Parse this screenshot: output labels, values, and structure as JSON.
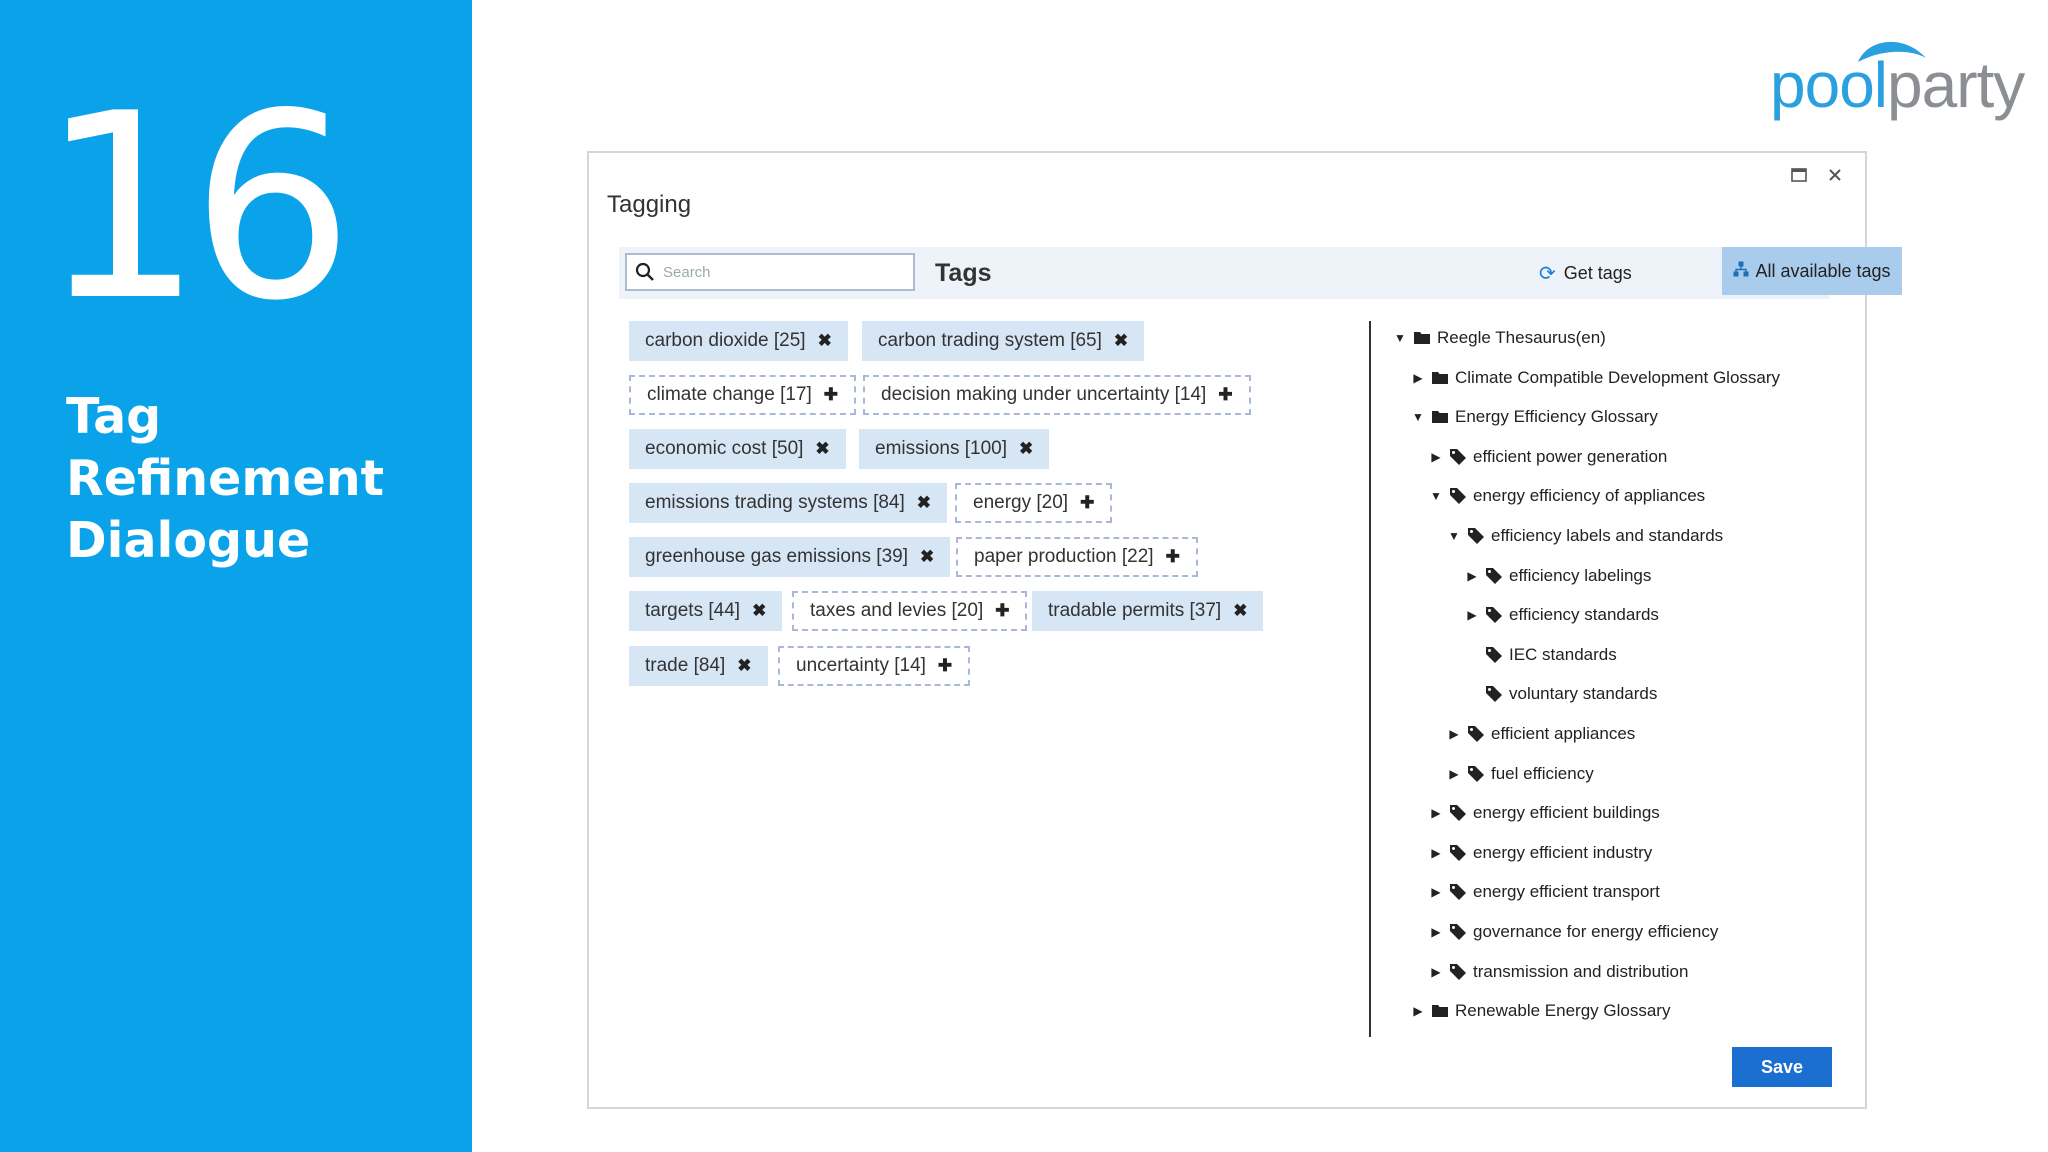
{
  "slide": {
    "number": "16",
    "title_line1": "Tag Refinement",
    "title_line2": "Dialogue"
  },
  "logo": {
    "part1": "pool",
    "part2": "party"
  },
  "dialog": {
    "title": "Tagging",
    "maximize_icon": "maximize-icon",
    "close_icon": "close-icon",
    "search_placeholder": "Search",
    "tags_label": "Tags",
    "get_tags_label": "Get tags",
    "all_tags_label": "All available tags",
    "save_label": "Save"
  },
  "tags": [
    {
      "label": "carbon dioxide [25]",
      "state": "assigned"
    },
    {
      "label": "carbon trading system [65]",
      "state": "assigned"
    },
    {
      "label": "climate change [17]",
      "state": "suggested"
    },
    {
      "label": "decision making under uncertainty [14]",
      "state": "suggested"
    },
    {
      "label": "economic cost [50]",
      "state": "assigned"
    },
    {
      "label": "emissions [100]",
      "state": "assigned"
    },
    {
      "label": "emissions trading systems [84]",
      "state": "assigned"
    },
    {
      "label": "energy [20]",
      "state": "suggested"
    },
    {
      "label": "greenhouse gas emissions [39]",
      "state": "assigned"
    },
    {
      "label": "paper production [22]",
      "state": "suggested"
    },
    {
      "label": "targets [44]",
      "state": "assigned"
    },
    {
      "label": "taxes and levies [20]",
      "state": "suggested"
    },
    {
      "label": "tradable permits [37]",
      "state": "assigned"
    },
    {
      "label": "trade [84]",
      "state": "assigned"
    },
    {
      "label": "uncertainty [14]",
      "state": "suggested"
    }
  ],
  "tree": [
    {
      "label": "Reegle Thesaurus(en)",
      "level": 0,
      "expander": "expanded",
      "icon": "folder-icon"
    },
    {
      "label": "Climate Compatible Development Glossary",
      "level": 1,
      "expander": "collapsed",
      "icon": "folder-icon"
    },
    {
      "label": "Energy Efficiency Glossary",
      "level": 1,
      "expander": "expanded",
      "icon": "folder-icon"
    },
    {
      "label": "efficient power generation",
      "level": 2,
      "expander": "collapsed",
      "icon": "tag-icon"
    },
    {
      "label": "energy efficiency of appliances",
      "level": 2,
      "expander": "expanded",
      "icon": "tag-icon"
    },
    {
      "label": "efficiency labels and standards",
      "level": 3,
      "expander": "expanded",
      "icon": "tag-icon"
    },
    {
      "label": "efficiency labelings",
      "level": 4,
      "expander": "collapsed",
      "icon": "tag-icon"
    },
    {
      "label": "efficiency standards",
      "level": 4,
      "expander": "collapsed",
      "icon": "tag-icon"
    },
    {
      "label": "IEC standards",
      "level": 4,
      "expander": "none",
      "icon": "tag-icon"
    },
    {
      "label": "voluntary standards",
      "level": 4,
      "expander": "none",
      "icon": "tag-icon"
    },
    {
      "label": "efficient appliances",
      "level": 3,
      "expander": "collapsed",
      "icon": "tag-icon"
    },
    {
      "label": "fuel efficiency",
      "level": 3,
      "expander": "collapsed",
      "icon": "tag-icon"
    },
    {
      "label": "energy efficient buildings",
      "level": 2,
      "expander": "collapsed",
      "icon": "tag-icon"
    },
    {
      "label": "energy efficient industry",
      "level": 2,
      "expander": "collapsed",
      "icon": "tag-icon"
    },
    {
      "label": "energy efficient transport",
      "level": 2,
      "expander": "collapsed",
      "icon": "tag-icon"
    },
    {
      "label": "governance for energy efficiency",
      "level": 2,
      "expander": "collapsed",
      "icon": "tag-icon"
    },
    {
      "label": "transmission and distribution",
      "level": 2,
      "expander": "collapsed",
      "icon": "tag-icon"
    },
    {
      "label": "Renewable Energy Glossary",
      "level": 1,
      "expander": "collapsed",
      "icon": "folder-icon"
    }
  ],
  "colors": {
    "side_panel": "#0aa3e9",
    "assigned_tag": "#d6e6f5",
    "primary_button": "#1a6fd1"
  }
}
